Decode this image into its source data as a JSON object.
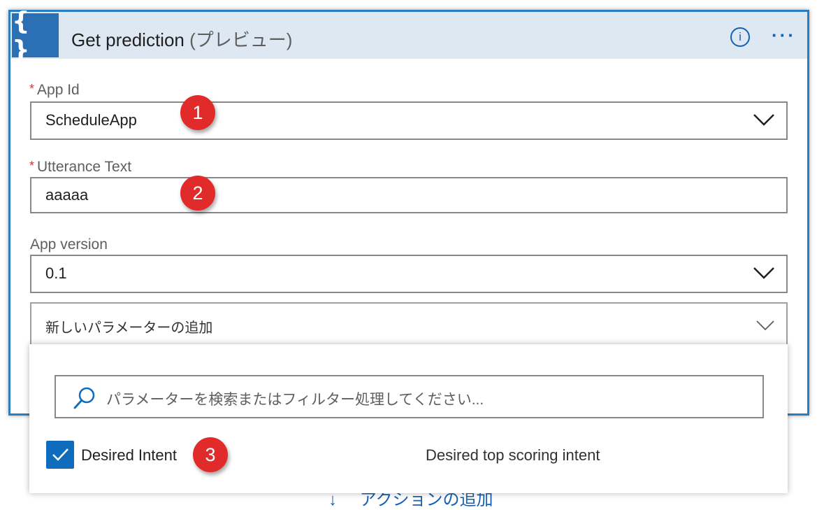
{
  "header": {
    "icon_glyph": "{ }",
    "title": "Get prediction",
    "title_suffix": "(プレビュー)",
    "info_icon": "info-icon",
    "more_glyph": "···"
  },
  "fields": {
    "app_id": {
      "required_mark": "*",
      "label": "App Id",
      "value": "ScheduleApp"
    },
    "utterance": {
      "required_mark": "*",
      "label": "Utterance Text",
      "value": "aaaaa"
    },
    "app_version": {
      "label": "App version",
      "value": "0.1"
    },
    "add_parameter": {
      "label": "新しいパラメーターの追加"
    }
  },
  "badges": [
    "1",
    "2",
    "3"
  ],
  "dropdown": {
    "search_placeholder": "パラメーターを検索またはフィルター処理してください...",
    "option": {
      "label": "Desired Intent",
      "checked": true,
      "description": "Desired top scoring intent"
    }
  },
  "footer": {
    "arrow": "↓",
    "add_action_label": "アクションの追加"
  },
  "colors": {
    "accent": "#2b6fb5",
    "header_bg": "#dde8f3",
    "badge": "#e12b2b",
    "checkbox": "#0f6cbd",
    "required": "#d13438"
  }
}
